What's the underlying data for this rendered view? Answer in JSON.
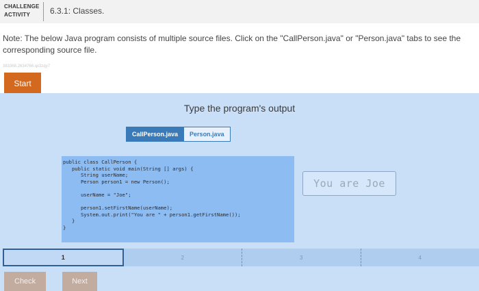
{
  "header": {
    "badge_line1": "CHALLENGE",
    "badge_line2": "ACTIVITY",
    "title": "6.3.1: Classes."
  },
  "note": "Note: The below Java program consists of multiple source files. Click on the \"CallPerson.java\" or \"Person.java\" tabs to see the corresponding source file.",
  "tracking_id": "383368.2634766.qx3zqy7",
  "start_label": "Start",
  "prompt": "Type the program's output",
  "tabs": [
    {
      "label": "CallPerson.java",
      "active": true
    },
    {
      "label": "Person.java",
      "active": false
    }
  ],
  "code_lines": [
    "public class CallPerson {",
    "   public static void main(String [] args) {",
    "      String userName;",
    "      Person person1 = new Person();",
    "",
    "      userName = \"Joe\";",
    "",
    "      person1.setFirstName(userName);",
    "      System.out.print(\"You are \" + person1.getFirstName());",
    "   }",
    "}"
  ],
  "output_value": "You are Joe",
  "steps": [
    "1",
    "2",
    "3",
    "4"
  ],
  "current_step": "1",
  "check_label": "Check",
  "next_label": "Next",
  "colors": {
    "start_button": "#d2691e",
    "panel_bg": "#c9dff8",
    "code_bg": "#8dbcf3",
    "tab_active": "#3b7ab8",
    "disabled_button": "#c2ab9f"
  }
}
